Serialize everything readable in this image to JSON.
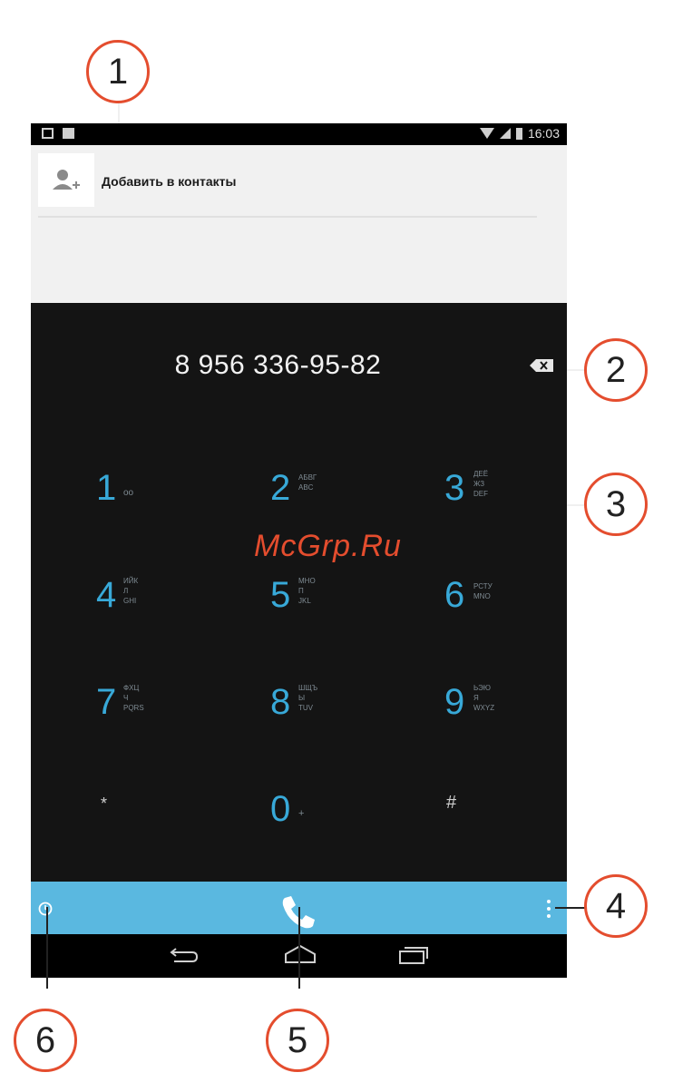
{
  "status_bar": {
    "time": "16:03"
  },
  "contact": {
    "add_label": "Добавить в контакты"
  },
  "dialer": {
    "number": "8 956 336-95-82"
  },
  "keypad": {
    "k1": {
      "digit": "1",
      "letters": "oo"
    },
    "k2": {
      "digit": "2",
      "letters": "АБВГ\nABC"
    },
    "k3": {
      "digit": "3",
      "letters": "ДЕЁ\nЖЗ\nDEF"
    },
    "k4": {
      "digit": "4",
      "letters": "ИЙК\nЛ\nGHI"
    },
    "k5": {
      "digit": "5",
      "letters": "МНО\nП\nJKL"
    },
    "k6": {
      "digit": "6",
      "letters": "РСТУ\nMNO"
    },
    "k7": {
      "digit": "7",
      "letters": "ФХЦ\nЧ\nPQRS"
    },
    "k8": {
      "digit": "8",
      "letters": "ШЩЪ\nЫ\nTUV"
    },
    "k9": {
      "digit": "9",
      "letters": "ЬЭЮ\nЯ\nWXYZ"
    },
    "star": {
      "digit": "*"
    },
    "k0": {
      "digit": "0",
      "letters": "+"
    },
    "hash": {
      "digit": "#"
    }
  },
  "callouts": [
    "1",
    "2",
    "3",
    "4",
    "5",
    "6"
  ],
  "watermark": "McGrp.Ru",
  "colors": {
    "accent": "#38a9d8",
    "action_bar": "#5ab8e0",
    "callout_border": "#e44d2e"
  }
}
